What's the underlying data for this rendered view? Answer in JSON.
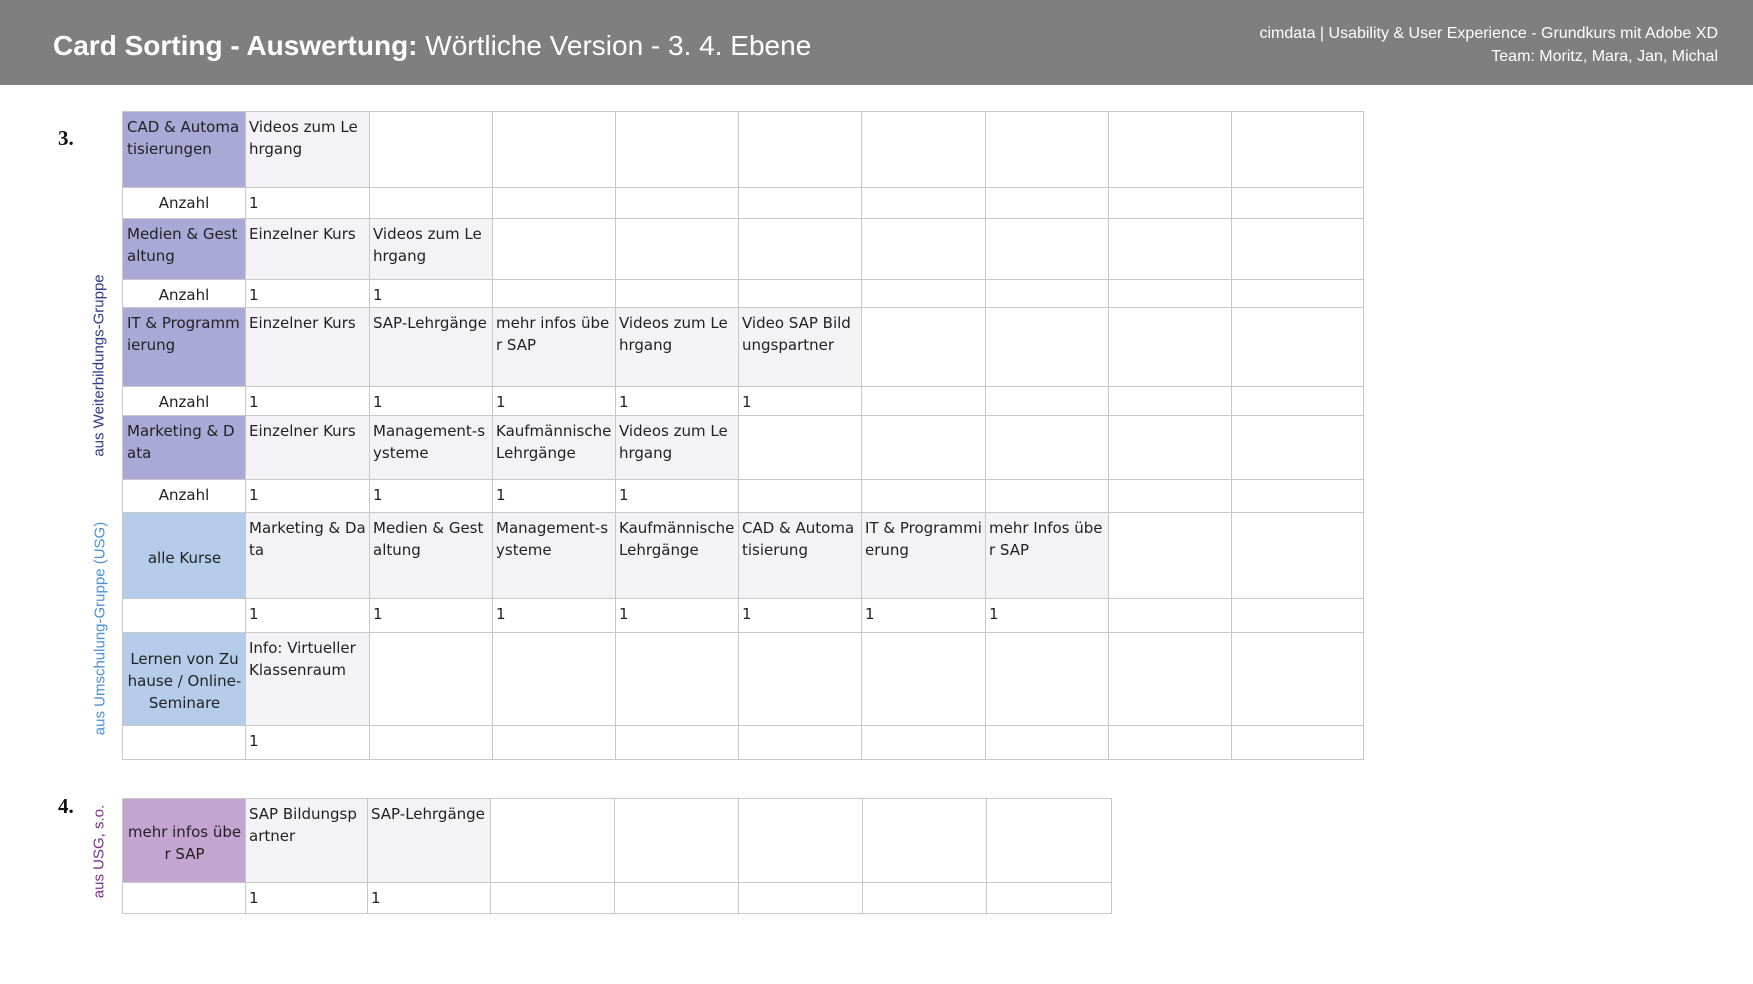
{
  "header": {
    "title_bold": "Card Sorting - Auswertung:",
    "title_rest": " Wörtliche Version - 3. 4.  Ebene",
    "meta_line1": "cimdata | Usability & User Experience - Grundkurs mit Adobe XD",
    "meta_line2": "Team: Moritz, Mara, Jan, Michal"
  },
  "section3": {
    "number": "3.",
    "label_weiterbildung": "aus Weiterbildungs-Gruppe",
    "label_umschulung": "aus Umschulung-Gruppe (USG)",
    "anzahl": "Anzahl",
    "rows": [
      {
        "category": "CAD & Automatisierungen",
        "items": [
          "Videos zum Lehrgang"
        ],
        "counts": [
          "1"
        ]
      },
      {
        "category": "Medien & Gestaltung",
        "items": [
          "Einzelner Kurs",
          "Videos zum Lehrgang"
        ],
        "counts": [
          "1",
          "1"
        ]
      },
      {
        "category": "IT & Programmierung",
        "items": [
          "Einzelner Kurs",
          "SAP-Lehrgänge",
          "mehr infos über SAP",
          "Videos zum Lehrgang",
          "Video SAP Bildungspartner"
        ],
        "counts": [
          "1",
          "1",
          "1",
          "1",
          "1"
        ]
      },
      {
        "category": "Marketing & Data",
        "items": [
          "Einzelner Kurs",
          "Management-systeme",
          "Kaufmännische Lehrgänge",
          "Videos zum Lehrgang"
        ],
        "counts": [
          "1",
          "1",
          "1",
          "1"
        ]
      },
      {
        "category": "alle Kurse",
        "items": [
          "Marketing & Data",
          "Medien & Gestaltung",
          "Management-systeme",
          "Kaufmännische Lehrgänge",
          "CAD & Automatisierung",
          "IT & Programmierung",
          "mehr Infos über SAP"
        ],
        "counts": [
          "1",
          "1",
          "1",
          "1",
          "1",
          "1",
          "1"
        ]
      },
      {
        "category": "Lernen von Zuhause / Online-Seminare",
        "items": [
          "Info: Virtueller Klassenraum"
        ],
        "counts": [
          "1"
        ]
      }
    ]
  },
  "section4": {
    "number": "4.",
    "label": "aus USG, s.o.",
    "rows": [
      {
        "category": "mehr infos über SAP",
        "items": [
          "SAP Bildungspartner",
          "SAP-Lehrgänge"
        ],
        "counts": [
          "1",
          "1"
        ]
      }
    ]
  },
  "colors": {
    "header_bg": "#7f7f7f",
    "weiterbildung_category": "#a9a8d6",
    "umschulung_category": "#b4cce9",
    "usg_category": "#c4a4d0",
    "label_weiterbildung": "#2e3a8c",
    "label_umschulung": "#4a90d9",
    "label_usg": "#7b2d8e"
  }
}
